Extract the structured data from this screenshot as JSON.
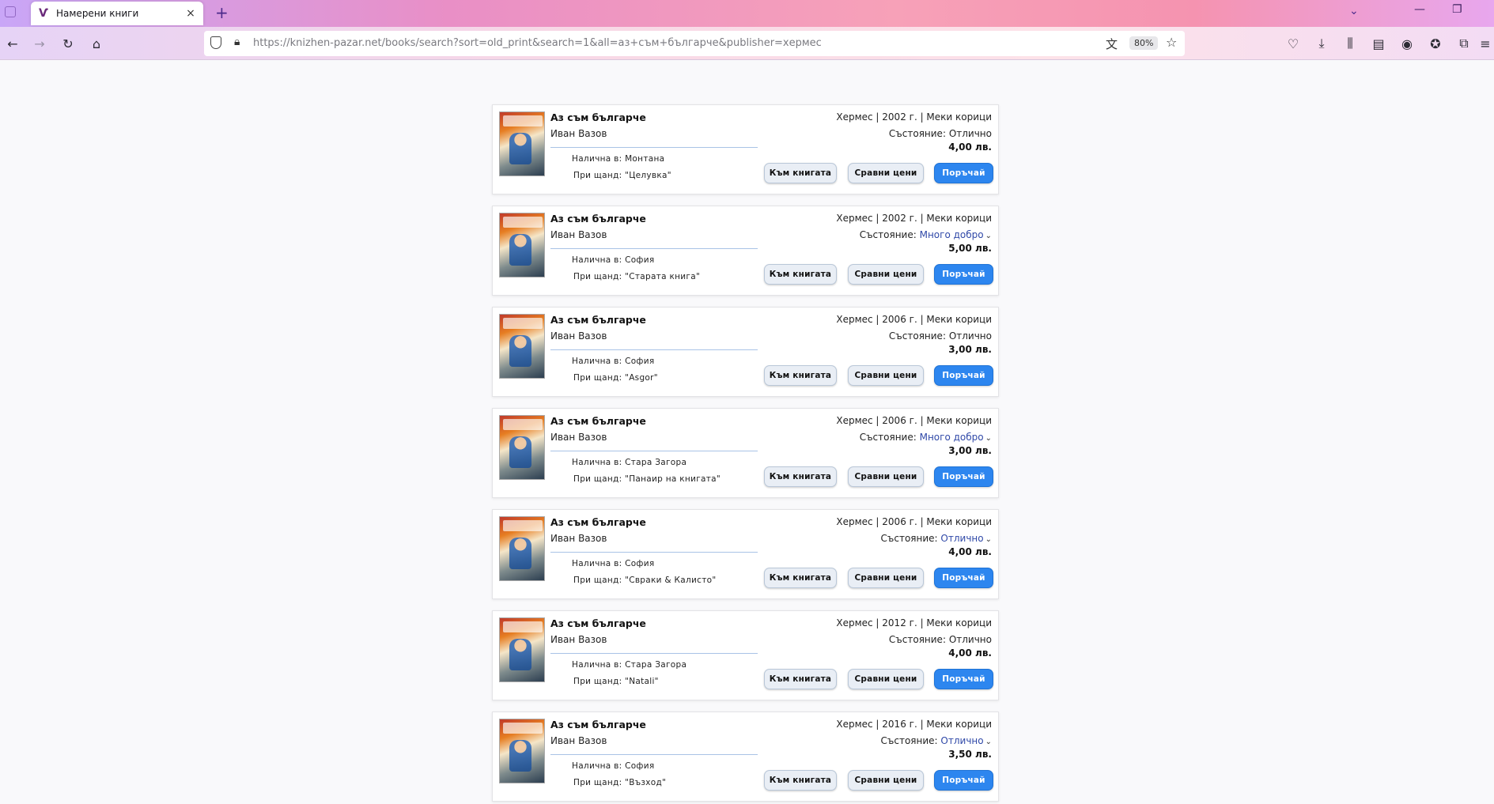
{
  "browser": {
    "tab_title": "Намерени книги",
    "favicon_glyph": "Ѵ",
    "new_tab_label": "+",
    "close_tab_glyph": "×",
    "url_host": "https://knizhen-pazar.net",
    "url_path": "/books/search?sort=old_print&search=1&all=аз+съм+българче&publisher=хермес",
    "zoom": "80%"
  },
  "results": [
    {
      "title": "Аз съм българче",
      "author": "Иван Вазов",
      "location_label": "Налична в:",
      "location": "Монтана",
      "shop_label": "При щанд:",
      "shop": "\"Целувка\"",
      "meta": "Хермес | 2002 г. | Меки корици",
      "condition_label": "Състояние:",
      "condition": "Отлично",
      "condition_expandable": false,
      "price": "4,00 лв."
    },
    {
      "title": "Аз съм българче",
      "author": "Иван Вазов",
      "location_label": "Налична в:",
      "location": "София",
      "shop_label": "При щанд:",
      "shop": "\"Старата книга\"",
      "meta": "Хермес | 2002 г. | Меки корици",
      "condition_label": "Състояние:",
      "condition": "Много добро",
      "condition_expandable": true,
      "price": "5,00 лв."
    },
    {
      "title": "Аз съм българче",
      "author": "Иван Вазов",
      "location_label": "Налична в:",
      "location": "София",
      "shop_label": "При щанд:",
      "shop": "\"Asgor\"",
      "meta": "Хермес | 2006 г. | Меки корици",
      "condition_label": "Състояние:",
      "condition": "Отлично",
      "condition_expandable": false,
      "price": "3,00 лв."
    },
    {
      "title": "Аз съм българче",
      "author": "Иван Вазов",
      "location_label": "Налична в:",
      "location": "Стара Загора",
      "shop_label": "При щанд:",
      "shop": "\"Панаир на книгата\"",
      "meta": "Хермес | 2006 г. | Меки корици",
      "condition_label": "Състояние:",
      "condition": "Много добро",
      "condition_expandable": true,
      "price": "3,00 лв."
    },
    {
      "title": "Аз съм българче",
      "author": "Иван Вазов",
      "location_label": "Налична в:",
      "location": "София",
      "shop_label": "При щанд:",
      "shop": "\"Свраки & Калисто\"",
      "meta": "Хермес | 2006 г. | Меки корици",
      "condition_label": "Състояние:",
      "condition": "Отлично",
      "condition_expandable": true,
      "price": "4,00 лв."
    },
    {
      "title": "Аз съм българче",
      "author": "Иван Вазов",
      "location_label": "Налична в:",
      "location": "Стара Загора",
      "shop_label": "При щанд:",
      "shop": "\"Natali\"",
      "meta": "Хермес | 2012 г. | Меки корици",
      "condition_label": "Състояние:",
      "condition": "Отлично",
      "condition_expandable": false,
      "price": "4,00 лв."
    },
    {
      "title": "Аз съм българче",
      "author": "Иван Вазов",
      "location_label": "Налична в:",
      "location": "София",
      "shop_label": "При щанд:",
      "shop": "\"Възход\"",
      "meta": "Хермес | 2016 г. | Меки корици",
      "condition_label": "Състояние:",
      "condition": "Отлично",
      "condition_expandable": true,
      "price": "3,50 лв."
    }
  ],
  "buttons": {
    "to_book": "Към книгата",
    "compare": "Сравни цени",
    "order": "Поръчай"
  },
  "colors": {
    "accent_button": "#2d86ef",
    "condition_link": "#3049a8"
  }
}
